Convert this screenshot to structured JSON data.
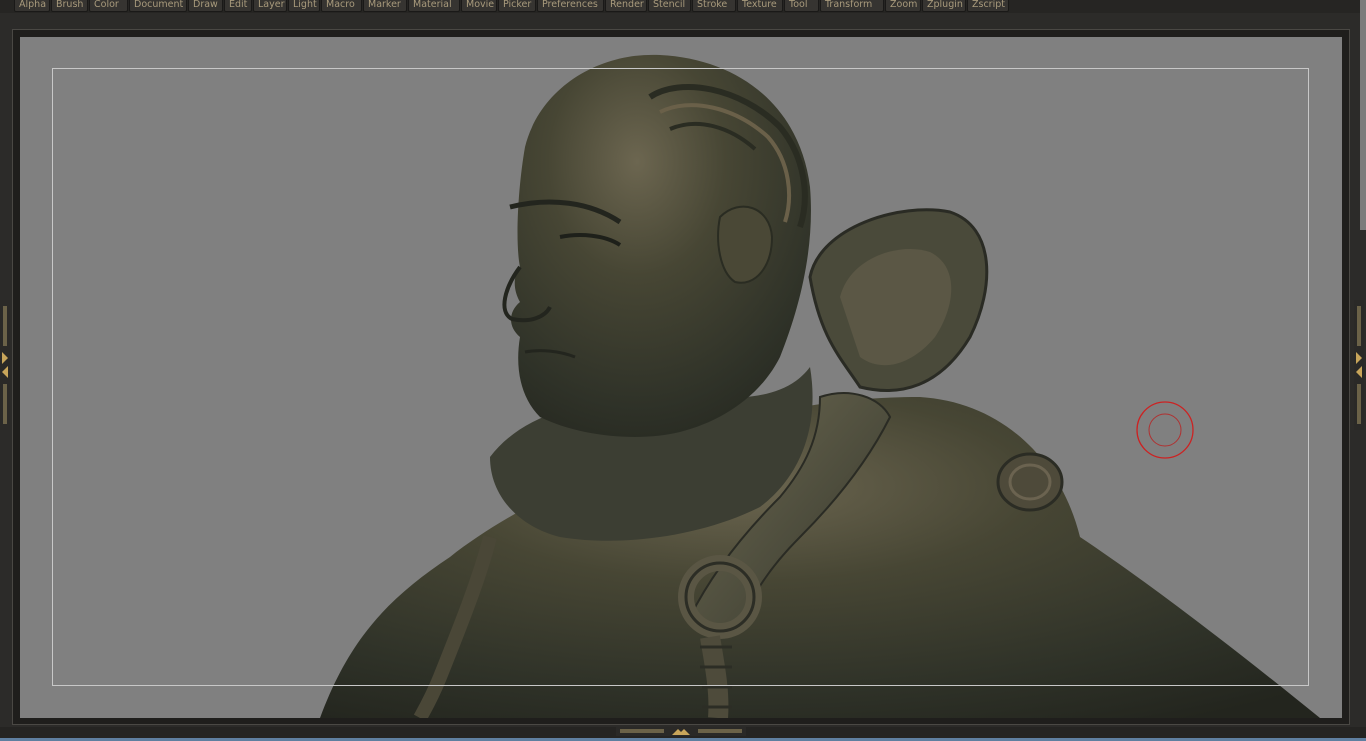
{
  "menu": {
    "items": [
      {
        "label": "Alpha"
      },
      {
        "label": "Brush"
      },
      {
        "label": "Color"
      },
      {
        "label": "Document"
      },
      {
        "label": "Draw"
      },
      {
        "label": "Edit"
      },
      {
        "label": "Layer"
      },
      {
        "label": "Light"
      },
      {
        "label": "Macro"
      },
      {
        "label": "Marker"
      },
      {
        "label": "Material"
      },
      {
        "label": "Movie"
      },
      {
        "label": "Picker"
      },
      {
        "label": "Preferences"
      },
      {
        "label": "Render"
      },
      {
        "label": "Stencil"
      },
      {
        "label": "Stroke"
      },
      {
        "label": "Texture"
      },
      {
        "label": "Tool"
      },
      {
        "label": "Transform"
      },
      {
        "label": "Zoom"
      },
      {
        "label": "Zplugin"
      },
      {
        "label": "Zscript"
      }
    ]
  },
  "canvas": {
    "background_color": "#808080",
    "safe_frame_color": "#c8c8c8",
    "model_color": "#3d4038",
    "model_highlight": "#7a6a4c",
    "brush_cursor_color": "#cc2222"
  },
  "icons": {
    "left_tray": "expand-left-tray-icon",
    "right_tray": "expand-right-tray-icon",
    "bottom_tray": "expand-bottom-tray-icon",
    "brush_cursor": "brush-cursor-icon"
  }
}
